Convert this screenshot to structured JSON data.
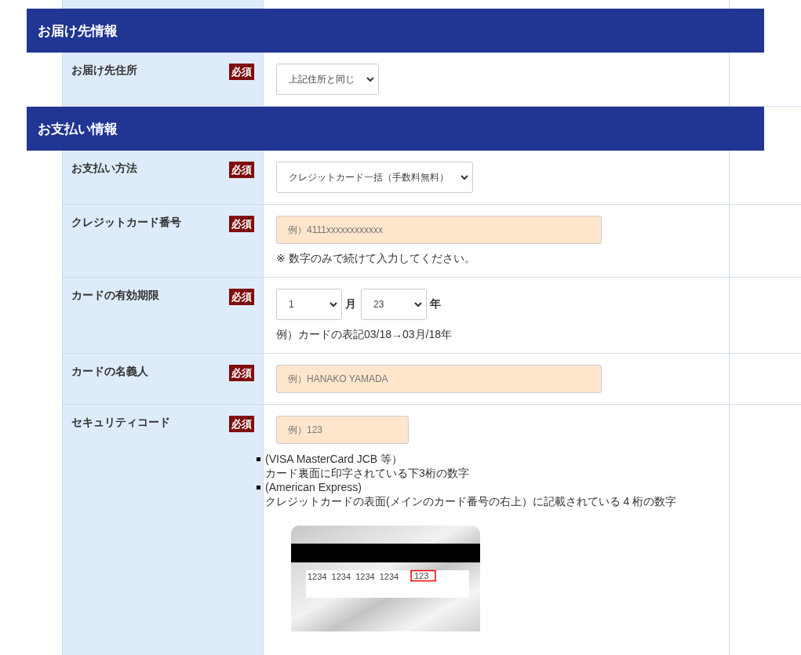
{
  "sections": [
    {
      "title": "お届け先情報",
      "rows": [
        {
          "kind": "select",
          "label": "お届け先住所",
          "required": true,
          "badge": "必須",
          "value": "上記住所と同じ"
        }
      ]
    },
    {
      "title": "お支払い情報",
      "rows": [
        {
          "kind": "select",
          "label": "お支払い方法",
          "required": true,
          "badge": "必須",
          "value": "クレジットカード一括（手数料無料）"
        },
        {
          "kind": "input",
          "label": "クレジットカード番号",
          "required": true,
          "badge": "必須",
          "placeholder": "例）4111xxxxxxxxxxxx",
          "note": "※ 数字のみで続けて入力してください。"
        },
        {
          "kind": "expiry",
          "label": "カードの有効期限",
          "required": true,
          "badge": "必須",
          "month": "1",
          "month_unit": "月",
          "year": "23",
          "year_unit": "年",
          "note": "例）カードの表記03/18→03月/18年"
        },
        {
          "kind": "input",
          "label": "カードの名義人",
          "required": true,
          "badge": "必須",
          "placeholder": "例）HANAKO YAMADA"
        },
        {
          "kind": "security",
          "label": "セキュリティコード",
          "required": true,
          "badge": "必須",
          "placeholder": "例）123",
          "notes": [
            {
              "title": "(VISA MasterCard JCB 等）",
              "text": "カード裏面に印字されている下3桁の数字"
            },
            {
              "title": "(American Express)",
              "text": "クレジットカードの表面(メインのカード番号の右上）に記載されている 4 桁の数字"
            }
          ],
          "card": {
            "numbers": "1234  1234  1234  1234",
            "code": "123"
          }
        }
      ]
    }
  ]
}
